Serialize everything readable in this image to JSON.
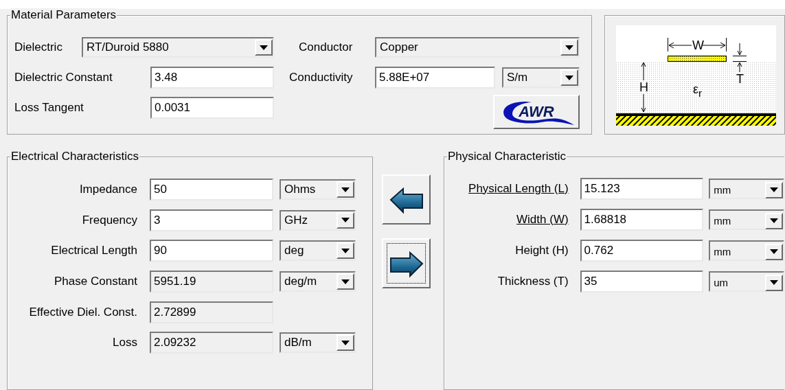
{
  "material_parameters": {
    "title": "Material Parameters",
    "dielectric": {
      "label": "Dielectric",
      "value": "RT/Duroid 5880"
    },
    "dielectric_constant": {
      "label": "Dielectric Constant",
      "value": "3.48"
    },
    "loss_tangent": {
      "label": "Loss Tangent",
      "value": "0.0031"
    },
    "conductor": {
      "label": "Conductor",
      "value": "Copper"
    },
    "conductivity": {
      "label": "Conductivity",
      "value": "5.88E+07",
      "unit": "S/m"
    },
    "logo_button": {
      "label": "AWR"
    }
  },
  "diagram": {
    "width_label": "W",
    "height_label": "H",
    "thickness_label": "T",
    "permittivity_label": "ε$_{r}$"
  },
  "electrical": {
    "title": "Electrical Characteristics",
    "rows": [
      {
        "label": "Impedance",
        "value": "50",
        "editable": true,
        "unit": "Ohms"
      },
      {
        "label": "Frequency",
        "value": "3",
        "editable": true,
        "unit": "GHz"
      },
      {
        "label": "Electrical Length",
        "value": "90",
        "editable": true,
        "unit": "deg"
      },
      {
        "label": "Phase Constant",
        "value": "5951.19",
        "editable": false,
        "unit": "deg/m"
      },
      {
        "label": "Effective Diel. Const.",
        "value": "2.72899",
        "editable": false
      },
      {
        "label": "Loss",
        "value": "2.09232",
        "editable": false,
        "unit": "dB/m"
      }
    ]
  },
  "transfer_buttons": [
    {
      "kind": "left",
      "focused": false
    },
    {
      "kind": "right",
      "focused": true
    }
  ],
  "physical": {
    "title": "Physical Characteristic",
    "rows": [
      {
        "label": "Physical Length (L)",
        "underlined": true,
        "value": "15.123",
        "editable": true,
        "unit": "mm"
      },
      {
        "label": "Width (W)",
        "underlined": true,
        "value": "1.68818",
        "editable": true,
        "unit": "mm"
      },
      {
        "label": "Height (H)",
        "underlined": false,
        "value": "0.762",
        "editable": true,
        "unit": "mm"
      },
      {
        "label": "Thickness (T)",
        "underlined": false,
        "value": "35",
        "editable": true,
        "unit": "um"
      }
    ]
  }
}
